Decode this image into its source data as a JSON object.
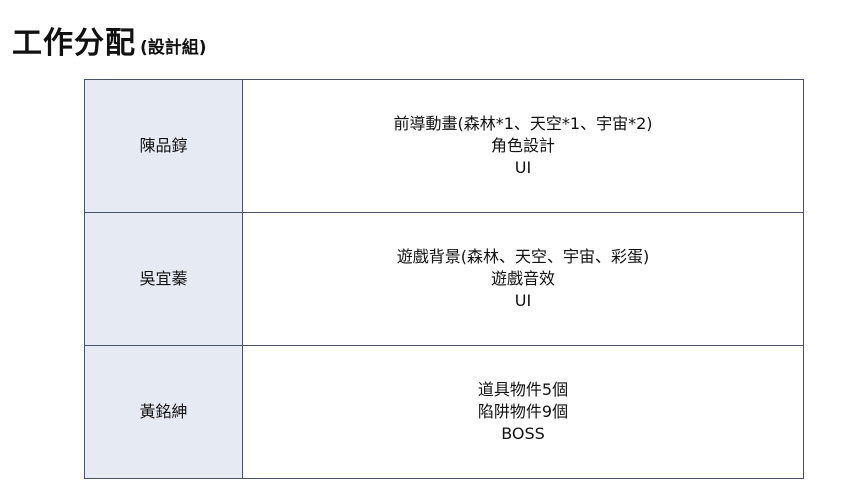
{
  "header": {
    "title": "工作分配",
    "subtitle": "(設計組)"
  },
  "members": [
    {
      "name": "陳品錞",
      "tasks": [
        "前導動畫(森林*1、天空*1、宇宙*2)",
        "角色設計",
        "UI"
      ]
    },
    {
      "name": "吳宜蓁",
      "tasks": [
        "遊戲背景(森林、天空、宇宙、彩蛋)",
        "遊戲音效",
        "UI"
      ]
    },
    {
      "name": "黃銘紳",
      "tasks": [
        "道具物件5個",
        "陷阱物件9個",
        "BOSS"
      ]
    }
  ],
  "colors": {
    "name_cell_bg": "#e6eaf3",
    "border": "#4a5468"
  }
}
